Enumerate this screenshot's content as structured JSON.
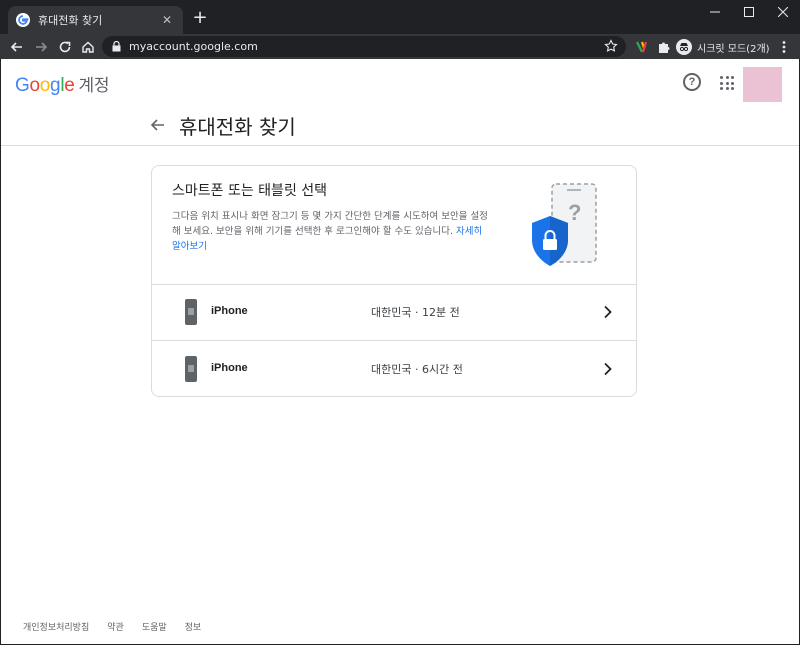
{
  "browser": {
    "tab_title": "휴대전화 찾기",
    "tab_close": "✕",
    "new_tab": "+",
    "url": "myaccount.google.com",
    "incognito_label": "시크릿 모드(2개)"
  },
  "header": {
    "logo_letters": [
      "G",
      "o",
      "o",
      "g",
      "l",
      "e"
    ],
    "logo_colors": [
      "#4285f4",
      "#ea4335",
      "#fbbc05",
      "#4285f4",
      "#34a853",
      "#ea4335"
    ],
    "account_label": "계정",
    "help_glyph": "?"
  },
  "page": {
    "title": "휴대전화 찾기"
  },
  "card": {
    "heading": "스마트폰 또는 태블릿 선택",
    "description": "그다음 위치 표시나 화면 잠그기 등 몇 가지 간단한 단계를 시도하여 보안을 설정해 보세요. 보안을 위해 기기를 선택한 후 로그인해야 할 수도 있습니다.",
    "learn_more": "자세히 알아보기"
  },
  "devices": [
    {
      "name": "iPhone",
      "info": "대한민국 · 12분 전"
    },
    {
      "name": "iPhone",
      "info": "대한민국 · 6시간 전"
    }
  ],
  "footer": {
    "links": [
      "개인정보처리방침",
      "약관",
      "도움말",
      "정보"
    ]
  },
  "colors": {
    "accent": "#1a73e8",
    "shield": "#1a73e8",
    "profile": "#ebc2d3"
  }
}
